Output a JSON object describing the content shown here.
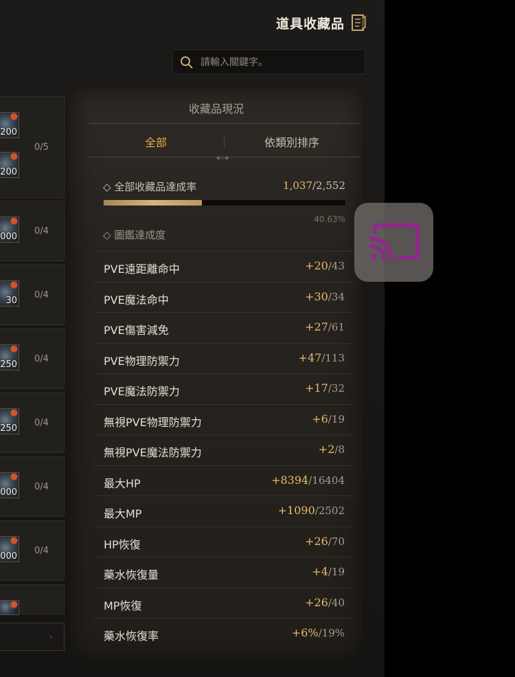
{
  "header": {
    "title": "道具收藏品",
    "icon": "collection-book-icon"
  },
  "search": {
    "placeholder": "請輸入關鍵字。"
  },
  "list": {
    "cards": [
      {
        "count": "0/5",
        "thumbs": [
          "200",
          "200"
        ]
      },
      {
        "count": "0/4",
        "thumbs": [
          "000"
        ]
      },
      {
        "count": "0/4",
        "thumbs": [
          "30"
        ]
      },
      {
        "count": "0/4",
        "thumbs": [
          "250"
        ]
      },
      {
        "count": "0/4",
        "thumbs": [
          "250"
        ]
      },
      {
        "count": "0/4",
        "thumbs": [
          "000"
        ]
      },
      {
        "count": "0/4",
        "thumbs": [
          "000"
        ]
      },
      {
        "count": "",
        "thumbs": [
          ""
        ]
      }
    ]
  },
  "panel": {
    "title": "收藏品現況",
    "tabs": {
      "all": "全部",
      "category": "依類別排序"
    },
    "rate_label": "◇ 全部收藏品達成率",
    "rate_current": "1,037",
    "rate_total": "/2,552",
    "progress_fraction": 0.4063,
    "progress_pct": "40.63%",
    "collection_label": "◇ 圖鑑達成度",
    "stats": [
      {
        "name": "PVE遠距離命中",
        "current": "+20",
        "max": "/43"
      },
      {
        "name": "PVE魔法命中",
        "current": "+30",
        "max": "/34"
      },
      {
        "name": "PVE傷害減免",
        "current": "+27",
        "max": "/61"
      },
      {
        "name": "PVE物理防禦力",
        "current": "+47",
        "max": "/113"
      },
      {
        "name": "PVE魔法防禦力",
        "current": "+17",
        "max": "/32"
      },
      {
        "name": "無視PVE物理防禦力",
        "current": "+6",
        "max": "/19"
      },
      {
        "name": "無視PVE魔法防禦力",
        "current": "+2",
        "max": "/8"
      },
      {
        "name": "最大HP",
        "current": "+8394",
        "max": "/16404"
      },
      {
        "name": "最大MP",
        "current": "+1090",
        "max": "/2502"
      },
      {
        "name": "HP恢復",
        "current": "+26",
        "max": "/70"
      },
      {
        "name": "藥水恢復量",
        "current": "+4",
        "max": "/19"
      },
      {
        "name": "MP恢復",
        "current": "+26",
        "max": "/40"
      },
      {
        "name": "藥水恢復率",
        "current": "+6%",
        "max": "/19%"
      }
    ]
  },
  "overlay": {
    "icon": "screen-cast-icon"
  },
  "colors": {
    "accent": "#e8bb6e",
    "tab_active": "#e8a84a",
    "cast": "#8e2a8c"
  }
}
